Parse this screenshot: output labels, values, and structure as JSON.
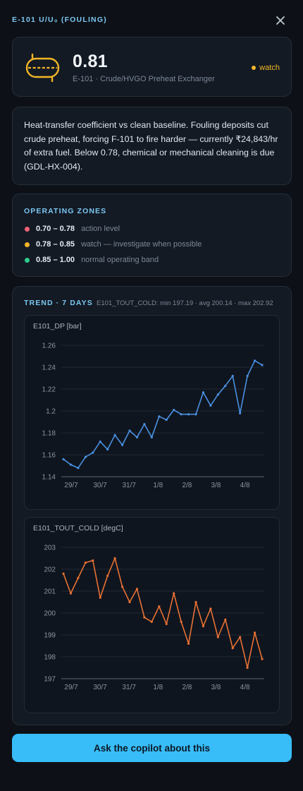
{
  "panel": {
    "title": "E-101 U/U₀ (FOULING)"
  },
  "kpi": {
    "value": "0.81",
    "subtitle": "E-101 · Crude/HVGO Preheat Exchanger",
    "status_label": "watch",
    "status_color": "#f4b625",
    "icon": "heat-exchanger-icon"
  },
  "description": "Heat-transfer coefficient vs clean baseline. Fouling deposits cut crude preheat, forcing F-101 to fire harder — currently ₹24,843/hr of extra fuel. Below 0.78, chemical or mechanical cleaning is due (GDL-HX-004).",
  "zones": {
    "title": "OPERATING ZONES",
    "items": [
      {
        "range": "0.70 – 0.78",
        "label": "action level",
        "color": "#f06277"
      },
      {
        "range": "0.78 – 0.85",
        "label": "watch — investigate when possible",
        "color": "#f4b625"
      },
      {
        "range": "0.85 – 1.00",
        "label": "normal operating band",
        "color": "#2fcb8c"
      }
    ]
  },
  "trend": {
    "title": "TREND · 7 DAYS",
    "stats": "E101_TOUT_COLD: min 197.19 · avg 200.14 · max 202.92"
  },
  "chart_data": [
    {
      "type": "line",
      "title": "E101_DP [bar]",
      "color": "#4a90e2",
      "ylim": [
        1.14,
        1.26
      ],
      "yticks": [
        "1.26",
        "1.24",
        "1.22",
        "1.2",
        "1.18",
        "1.16",
        "1.14"
      ],
      "xticks": [
        "29/7",
        "30/7",
        "31/7",
        "1/8",
        "2/8",
        "3/8",
        "4/8"
      ],
      "x": [
        "29/7 00:00",
        "29/7 06:00",
        "29/7 12:00",
        "29/7 18:00",
        "30/7 00:00",
        "30/7 06:00",
        "30/7 12:00",
        "30/7 18:00",
        "31/7 00:00",
        "31/7 06:00",
        "31/7 12:00",
        "31/7 18:00",
        "1/8 00:00",
        "1/8 06:00",
        "1/8 12:00",
        "1/8 18:00",
        "2/8 00:00",
        "2/8 06:00",
        "2/8 12:00",
        "2/8 18:00",
        "3/8 00:00",
        "3/8 06:00",
        "3/8 12:00",
        "3/8 18:00",
        "4/8 00:00",
        "4/8 06:00",
        "4/8 12:00",
        "4/8 18:00"
      ],
      "values": [
        1.156,
        1.151,
        1.148,
        1.158,
        1.162,
        1.172,
        1.165,
        1.178,
        1.169,
        1.182,
        1.176,
        1.188,
        1.176,
        1.195,
        1.192,
        1.201,
        1.197,
        1.197,
        1.197,
        1.217,
        1.205,
        1.215,
        1.223,
        1.232,
        1.198,
        1.232,
        1.246,
        1.242
      ]
    },
    {
      "type": "line",
      "title": "E101_TOUT_COLD [degC]",
      "color": "#e87034",
      "ylim": [
        197,
        203
      ],
      "yticks": [
        "203",
        "202",
        "201",
        "200",
        "199",
        "198",
        "197"
      ],
      "xticks": [
        "29/7",
        "30/7",
        "31/7",
        "1/8",
        "2/8",
        "3/8",
        "4/8"
      ],
      "x": [
        "29/7 00:00",
        "29/7 06:00",
        "29/7 12:00",
        "29/7 18:00",
        "30/7 00:00",
        "30/7 06:00",
        "30/7 12:00",
        "30/7 18:00",
        "31/7 00:00",
        "31/7 06:00",
        "31/7 12:00",
        "31/7 18:00",
        "1/8 00:00",
        "1/8 06:00",
        "1/8 12:00",
        "1/8 18:00",
        "2/8 00:00",
        "2/8 06:00",
        "2/8 12:00",
        "2/8 18:00",
        "3/8 00:00",
        "3/8 06:00",
        "3/8 12:00",
        "3/8 18:00",
        "4/8 00:00",
        "4/8 06:00",
        "4/8 12:00",
        "4/8 18:00"
      ],
      "values": [
        201.8,
        200.9,
        201.6,
        202.3,
        202.4,
        200.7,
        201.7,
        202.5,
        201.2,
        200.5,
        201.1,
        199.8,
        199.6,
        200.3,
        199.5,
        200.9,
        199.6,
        198.6,
        200.5,
        199.4,
        200.2,
        198.9,
        199.7,
        198.4,
        198.9,
        197.5,
        199.1,
        197.9
      ]
    }
  ],
  "cta": {
    "label": "Ask the copilot about this"
  }
}
